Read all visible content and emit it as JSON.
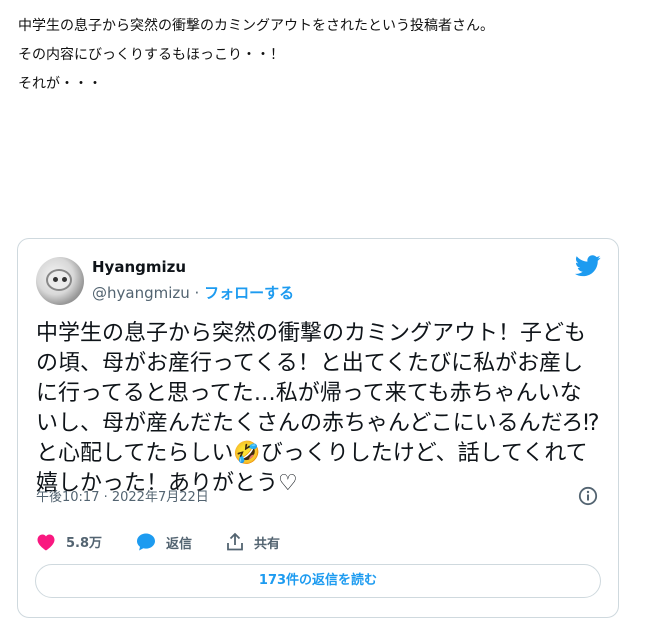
{
  "intro": {
    "line1": "中学生の息子から突然の衝撃のカミングアウトをされたという投稿者さん。",
    "line2": "その内容にびっくりするもほっこり・・！",
    "line3": "それが・・・"
  },
  "tweet": {
    "author_name": "Hyangmizu",
    "handle": "@hyangmizu",
    "separator": " · ",
    "follow_label": "フォローする",
    "text_before_emoji": "中学生の息子から突然の衝撃のカミングアウト！子どもの頃、母がお産行ってくる！と出てくたびに私がお産しに行ってると思ってた…私が帰って来ても赤ちゃんいないし、母が産んだたくさんの赤ちゃんどこにいるんだろ⁉︎と心配してたらしい",
    "emoji": "🤣",
    "text_after_emoji": "びっくりしたけど、話してくれて嬉しかった！ありがとう♡",
    "timestamp": "午後10:17 · 2022年7月22日",
    "like_count": "5.8万",
    "reply_label": "返信",
    "share_label": "共有",
    "read_replies_label": "173件の返信を読む"
  },
  "colors": {
    "accent": "#1d9bf0",
    "like": "#f91880",
    "muted": "#536471",
    "border": "#cfd9de"
  },
  "icons": [
    "twitter-bird-icon",
    "info-icon",
    "heart-icon",
    "reply-icon",
    "share-icon"
  ]
}
